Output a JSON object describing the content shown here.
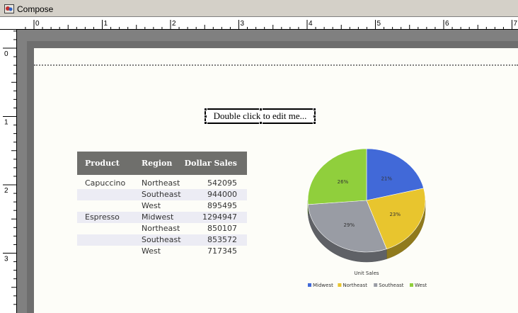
{
  "window": {
    "title": "Compose"
  },
  "ruler": {
    "horizontal_labels": [
      "0",
      "1",
      "2",
      "3",
      "4",
      "5",
      "6",
      "7"
    ],
    "vertical_labels": [
      "0",
      "1",
      "2",
      "3"
    ]
  },
  "text_box": {
    "text": "Double click to edit me..."
  },
  "table": {
    "headers": [
      "Product",
      "Region",
      "Dollar Sales"
    ],
    "rows": [
      {
        "product": "Capuccino",
        "region": "Northeast",
        "sales": "542095"
      },
      {
        "product": "",
        "region": "Southeast",
        "sales": "944000"
      },
      {
        "product": "",
        "region": "West",
        "sales": "895495"
      },
      {
        "product": "Espresso",
        "region": "Midwest",
        "sales": "1294947"
      },
      {
        "product": "",
        "region": "Northeast",
        "sales": "850107"
      },
      {
        "product": "",
        "region": "Southeast",
        "sales": "853572"
      },
      {
        "product": "",
        "region": "West",
        "sales": "717345"
      }
    ]
  },
  "chart_data": {
    "type": "pie",
    "title": "Unit Sales",
    "slices": [
      {
        "label": "Midwest",
        "value": 21,
        "display": "21%",
        "color": "#4169d8"
      },
      {
        "label": "Northeast",
        "value": 23,
        "display": "23%",
        "color": "#e8c52e"
      },
      {
        "label": "Southeast",
        "value": 29,
        "display": "29%",
        "color": "#999ca4"
      },
      {
        "label": "West",
        "value": 26,
        "display": "26%",
        "color": "#90cf3c"
      }
    ],
    "legend_placement": "bottom",
    "three_d": true
  }
}
